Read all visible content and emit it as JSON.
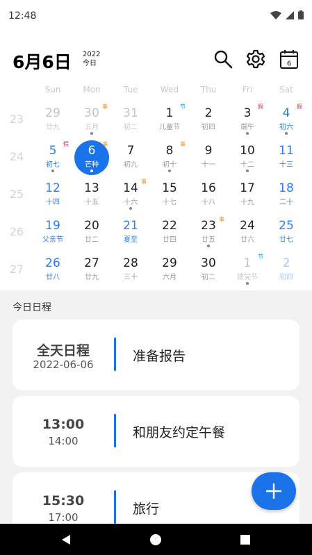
{
  "status_bar": {
    "time": "12:48"
  },
  "header": {
    "date": "6月6日",
    "year": "2022",
    "today_label": "今日",
    "calendar_icon_day": "6"
  },
  "calendar": {
    "weekdays": [
      "Sun",
      "Mon",
      "Tue",
      "Wed",
      "Thu",
      "Fri",
      "Sat"
    ],
    "weeks": [
      {
        "week_number": "23",
        "days": [
          {
            "num": "29",
            "lunar": "廿九",
            "other": true
          },
          {
            "num": "30",
            "lunar": "五月",
            "other": true,
            "badge": "事",
            "dot": true
          },
          {
            "num": "31",
            "lunar": "初二",
            "other": true
          },
          {
            "num": "1",
            "lunar": "儿童节",
            "badge": "节",
            "dark": true
          },
          {
            "num": "2",
            "lunar": "初四"
          },
          {
            "num": "3",
            "lunar": "端午",
            "badge": "假",
            "dot": true
          },
          {
            "num": "4",
            "lunar": "初六",
            "badge": "假",
            "weekend": true,
            "dot": true
          }
        ]
      },
      {
        "week_number": "24",
        "days": [
          {
            "num": "5",
            "lunar": "初七",
            "badge": "假",
            "weekend": true,
            "dot": true
          },
          {
            "num": "6",
            "lunar": "芒种",
            "badge": "事",
            "selected": true,
            "dot": true
          },
          {
            "num": "7",
            "lunar": "初九"
          },
          {
            "num": "8",
            "lunar": "初十",
            "badge": "事",
            "dot": true
          },
          {
            "num": "9",
            "lunar": "十一"
          },
          {
            "num": "10",
            "lunar": "十二",
            "dot": true
          },
          {
            "num": "11",
            "lunar": "十三",
            "weekend": true
          }
        ]
      },
      {
        "week_number": "25",
        "days": [
          {
            "num": "12",
            "lunar": "十四",
            "weekend": true
          },
          {
            "num": "13",
            "lunar": "十五"
          },
          {
            "num": "14",
            "lunar": "十六",
            "badge": "事",
            "dot": true
          },
          {
            "num": "15",
            "lunar": "十七"
          },
          {
            "num": "16",
            "lunar": "十八"
          },
          {
            "num": "17",
            "lunar": "十九"
          },
          {
            "num": "18",
            "lunar": "二十",
            "weekend": true
          }
        ]
      },
      {
        "week_number": "26",
        "days": [
          {
            "num": "19",
            "lunar": "父亲节",
            "weekend": true
          },
          {
            "num": "20",
            "lunar": "廿二"
          },
          {
            "num": "21",
            "lunar": "夏至",
            "holiday": true
          },
          {
            "num": "22",
            "lunar": "廿四"
          },
          {
            "num": "23",
            "lunar": "廿五",
            "badge": "事",
            "dot": true
          },
          {
            "num": "24",
            "lunar": "廿六"
          },
          {
            "num": "25",
            "lunar": "廿七",
            "weekend": true
          }
        ]
      },
      {
        "week_number": "27",
        "days": [
          {
            "num": "26",
            "lunar": "廿八",
            "weekend": true
          },
          {
            "num": "27",
            "lunar": "廿九"
          },
          {
            "num": "28",
            "lunar": "三十"
          },
          {
            "num": "29",
            "lunar": "六月"
          },
          {
            "num": "30",
            "lunar": "初二"
          },
          {
            "num": "1",
            "lunar": "建党节",
            "other": true,
            "badge": "节",
            "dot": true
          },
          {
            "num": "2",
            "lunar": "初四",
            "other": true,
            "weekend": true
          }
        ]
      }
    ]
  },
  "schedule": {
    "heading": "今日日程",
    "events": [
      {
        "time_main": "全天日程",
        "time_sub": "2022-06-06",
        "title": "准备报告"
      },
      {
        "time_main": "13:00",
        "time_sub": "14:00",
        "title": "和朋友约定午餐"
      },
      {
        "time_main": "15:30",
        "time_sub": "17:00",
        "title": "旅行"
      }
    ]
  },
  "colors": {
    "accent": "#1a73e8",
    "badge_event": "#e8912b",
    "badge_holiday": "#e0304a",
    "badge_festival": "#2b9be9"
  }
}
